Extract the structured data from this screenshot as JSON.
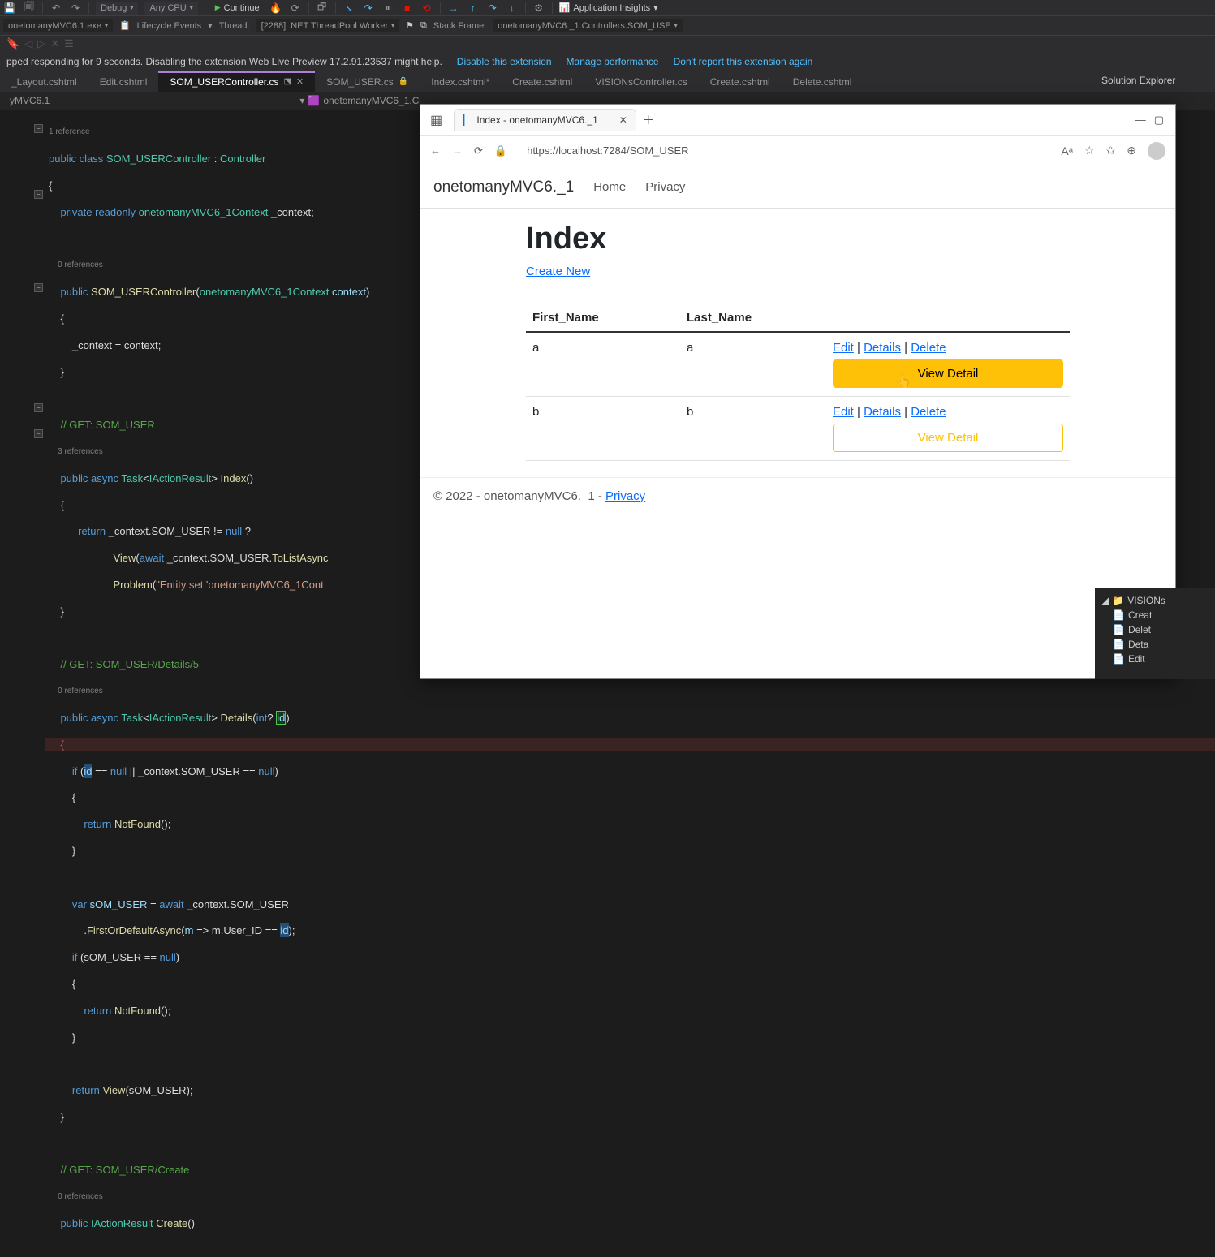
{
  "toolbar": {
    "config": "Debug",
    "platform": "Any CPU",
    "continue": "Continue",
    "insights": "Application Insights"
  },
  "debugbar": {
    "process": "onetomanyMVC6.1.exe",
    "lifecycle": "Lifecycle Events",
    "thread_label": "Thread:",
    "thread_value": "[2288] .NET ThreadPool Worker",
    "stackframe_label": "Stack Frame:",
    "stackframe_value": "onetomanyMVC6._1.Controllers.SOM_USE"
  },
  "notification": {
    "msg": "pped responding for 9 seconds. Disabling the extension Web Live Preview 17.2.91.23537 might help.",
    "link1": "Disable this extension",
    "link2": "Manage performance",
    "link3": "Don't report this extension again"
  },
  "tabs": [
    {
      "label": "_Layout.cshtml",
      "active": false
    },
    {
      "label": "Edit.cshtml",
      "active": false
    },
    {
      "label": "SOM_USERController.cs",
      "active": true
    },
    {
      "label": "SOM_USER.cs",
      "active": false
    },
    {
      "label": "Index.cshtml*",
      "active": false
    },
    {
      "label": "Create.cshtml",
      "active": false
    },
    {
      "label": "VISIONsController.cs",
      "active": false
    },
    {
      "label": "Create.cshtml",
      "active": false
    },
    {
      "label": "Delete.cshtml",
      "active": false
    }
  ],
  "solution_header": "Solution Explorer",
  "breadcrumb": {
    "p1": "yMVC6.1",
    "p2": "onetomanyMVC6_1.C"
  },
  "refs": {
    "r1": "1 reference",
    "r3": "3 references",
    "r0": "0 references"
  },
  "browser": {
    "tab_title": "Index - onetomanyMVC6._1",
    "url": "https://localhost:7284/SOM_USER",
    "brand": "onetomanyMVC6._1",
    "nav_home": "Home",
    "nav_privacy": "Privacy",
    "page_title": "Index",
    "create_link": "Create New",
    "th1": "First_Name",
    "th2": "Last_Name",
    "rows": [
      {
        "first": "a",
        "last": "a",
        "view_hover": true
      },
      {
        "first": "b",
        "last": "b",
        "view_hover": false
      }
    ],
    "action_edit": "Edit",
    "action_details": "Details",
    "action_delete": "Delete",
    "view_detail": "View Detail",
    "footer_text": "© 2022 - onetomanyMVC6._1 - ",
    "footer_link": "Privacy"
  },
  "solution_tree": {
    "folder": "VISIONs",
    "files": [
      "Creat",
      "Delet",
      "Deta",
      "Edit"
    ]
  }
}
